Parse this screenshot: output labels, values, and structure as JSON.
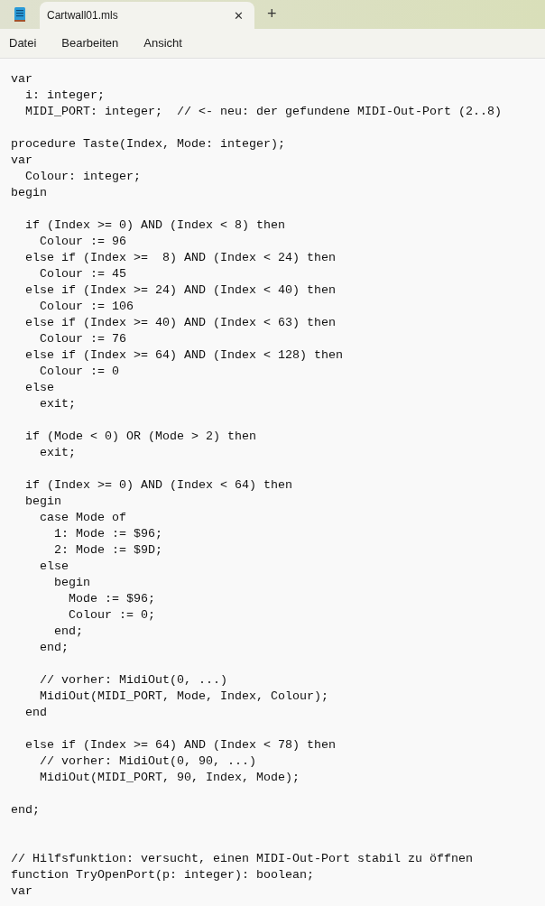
{
  "tab": {
    "title": "Cartwall01.mls",
    "close": "✕",
    "new_tab": "+"
  },
  "menu": [
    "Datei",
    "Bearbeiten",
    "Ansicht"
  ],
  "lines": [
    {
      "kind": "code",
      "text": "var"
    },
    {
      "kind": "code",
      "text": "  i: integer;"
    },
    {
      "kind": "code",
      "text": "  MIDI_PORT: integer;  // <- neu: der gefundene MIDI-Out-Port (2..8)"
    },
    {
      "kind": "blank"
    },
    {
      "kind": "code",
      "text": "procedure Taste(Index, Mode: integer);"
    },
    {
      "kind": "code",
      "text": "var"
    },
    {
      "kind": "code",
      "text": "  Colour: integer;"
    },
    {
      "kind": "code",
      "text": "begin"
    },
    {
      "kind": "blank"
    },
    {
      "kind": "code",
      "text": "  if (Index >= 0) AND (Index < 8) then"
    },
    {
      "kind": "code",
      "text": "    Colour := 96"
    },
    {
      "kind": "code",
      "text": "  else if (Index >=  8) AND (Index < 24) then"
    },
    {
      "kind": "code",
      "text": "    Colour := 45"
    },
    {
      "kind": "code",
      "text": "  else if (Index >= 24) AND (Index < 40) then"
    },
    {
      "kind": "code",
      "text": "    Colour := 106"
    },
    {
      "kind": "code",
      "text": "  else if (Index >= 40) AND (Index < 63) then"
    },
    {
      "kind": "code",
      "text": "    Colour := 76"
    },
    {
      "kind": "code",
      "text": "  else if (Index >= 64) AND (Index < 128) then"
    },
    {
      "kind": "code",
      "text": "    Colour := 0"
    },
    {
      "kind": "code",
      "text": "  else"
    },
    {
      "kind": "code",
      "text": "    exit;"
    },
    {
      "kind": "blank"
    },
    {
      "kind": "code",
      "text": "  if (Mode < 0) OR (Mode > 2) then"
    },
    {
      "kind": "code",
      "text": "    exit;"
    },
    {
      "kind": "blank"
    },
    {
      "kind": "code",
      "text": "  if (Index >= 0) AND (Index < 64) then"
    },
    {
      "kind": "code",
      "text": "  begin"
    },
    {
      "kind": "code",
      "text": "    case Mode of"
    },
    {
      "kind": "code",
      "text": "      1: Mode := $96;"
    },
    {
      "kind": "code",
      "text": "      2: Mode := $9D;"
    },
    {
      "kind": "code",
      "text": "    else"
    },
    {
      "kind": "code",
      "text": "      begin"
    },
    {
      "kind": "code",
      "text": "        Mode := $96;"
    },
    {
      "kind": "code",
      "text": "        Colour := 0;"
    },
    {
      "kind": "code",
      "text": "      end;"
    },
    {
      "kind": "code",
      "text": "    end;"
    },
    {
      "kind": "blank"
    },
    {
      "kind": "code",
      "text": "    // vorher: MidiOut(0, ...)"
    },
    {
      "kind": "code",
      "text": "    MidiOut(MIDI_PORT, Mode, Index, Colour);"
    },
    {
      "kind": "code",
      "text": "  end"
    },
    {
      "kind": "blank"
    },
    {
      "kind": "code",
      "text": "  else if (Index >= 64) AND (Index < 78) then"
    },
    {
      "kind": "code",
      "text": "    // vorher: MidiOut(0, 90, ...)"
    },
    {
      "kind": "code",
      "text": "    MidiOut(MIDI_PORT, 90, Index, Mode);"
    },
    {
      "kind": "blank"
    },
    {
      "kind": "code",
      "text": "end;"
    },
    {
      "kind": "blank"
    },
    {
      "kind": "blank"
    },
    {
      "kind": "code",
      "text": "// Hilfsfunktion: versucht, einen MIDI-Out-Port stabil zu öffnen"
    },
    {
      "kind": "code",
      "text": "function TryOpenPort(p: integer): boolean;"
    },
    {
      "kind": "code",
      "text": "var"
    }
  ]
}
